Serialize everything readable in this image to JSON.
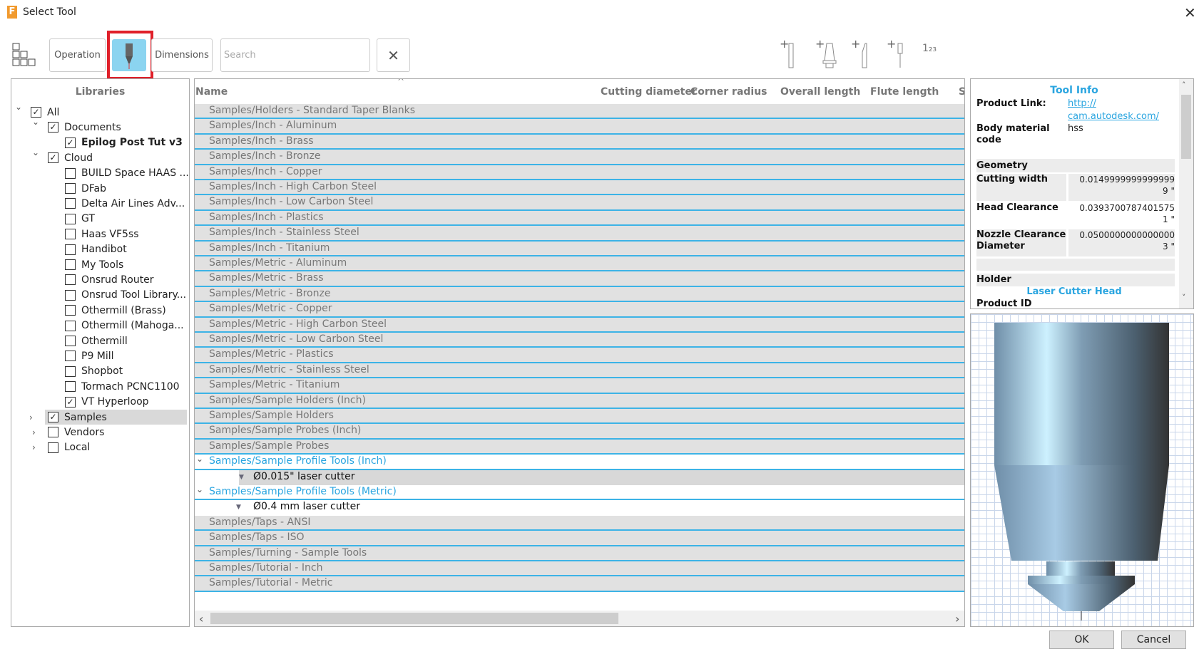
{
  "window": {
    "title": "Select Tool",
    "app_icon": "F"
  },
  "toolbar": {
    "operation": "Operation",
    "dimensions": "Dimensions",
    "search_placeholder": "Search",
    "clear": "✕",
    "number_icon": "1₂₃"
  },
  "libraries": {
    "header": "Libraries",
    "items": [
      {
        "label": "All",
        "checked": true,
        "level": 0,
        "expander": "open"
      },
      {
        "label": "Documents",
        "checked": true,
        "level": 1,
        "expander": "open"
      },
      {
        "label": "Epilog Post Tut v3",
        "checked": true,
        "level": 2,
        "bold": true
      },
      {
        "label": "Cloud",
        "checked": true,
        "level": 1,
        "expander": "open"
      },
      {
        "label": "BUILD Space HAAS ...",
        "checked": false,
        "level": 2
      },
      {
        "label": "DFab",
        "checked": false,
        "level": 2
      },
      {
        "label": "Delta Air Lines Adv...",
        "checked": false,
        "level": 2
      },
      {
        "label": "GT",
        "checked": false,
        "level": 2
      },
      {
        "label": "Haas VF5ss",
        "checked": false,
        "level": 2
      },
      {
        "label": "Handibot",
        "checked": false,
        "level": 2
      },
      {
        "label": "My Tools",
        "checked": false,
        "level": 2
      },
      {
        "label": "Onsrud Router",
        "checked": false,
        "level": 2
      },
      {
        "label": "Onsrud Tool Library...",
        "checked": false,
        "level": 2
      },
      {
        "label": "Othermill (Brass)",
        "checked": false,
        "level": 2
      },
      {
        "label": "Othermill (Mahoga...",
        "checked": false,
        "level": 2
      },
      {
        "label": "Othermill",
        "checked": false,
        "level": 2
      },
      {
        "label": "P9 Mill",
        "checked": false,
        "level": 2
      },
      {
        "label": "Shopbot",
        "checked": false,
        "level": 2
      },
      {
        "label": "Tormach PCNC1100",
        "checked": false,
        "level": 2
      },
      {
        "label": "VT Hyperloop",
        "checked": true,
        "level": 2
      },
      {
        "label": "Samples",
        "checked": true,
        "level": 1,
        "expander": "closed",
        "selected": true
      },
      {
        "label": "Vendors",
        "checked": false,
        "level": 1,
        "expander": "closed"
      },
      {
        "label": "Local",
        "checked": false,
        "level": 1,
        "expander": "closed"
      }
    ]
  },
  "list": {
    "columns": [
      "Name",
      "Cutting diameter",
      "Corner radius",
      "Overall length",
      "Flute length",
      "S"
    ],
    "rows": [
      {
        "label": "Samples/Holders - Standard Taper Blanks",
        "type": "group"
      },
      {
        "label": "Samples/Inch - Aluminum",
        "type": "group"
      },
      {
        "label": "Samples/Inch - Brass",
        "type": "group"
      },
      {
        "label": "Samples/Inch - Bronze",
        "type": "group"
      },
      {
        "label": "Samples/Inch - Copper",
        "type": "group"
      },
      {
        "label": "Samples/Inch - High Carbon Steel",
        "type": "group"
      },
      {
        "label": "Samples/Inch - Low Carbon Steel",
        "type": "group"
      },
      {
        "label": "Samples/Inch - Plastics",
        "type": "group"
      },
      {
        "label": "Samples/Inch - Stainless Steel",
        "type": "group"
      },
      {
        "label": "Samples/Inch - Titanium",
        "type": "group"
      },
      {
        "label": "Samples/Metric - Aluminum",
        "type": "group"
      },
      {
        "label": "Samples/Metric - Brass",
        "type": "group"
      },
      {
        "label": "Samples/Metric - Bronze",
        "type": "group"
      },
      {
        "label": "Samples/Metric - Copper",
        "type": "group"
      },
      {
        "label": "Samples/Metric - High Carbon Steel",
        "type": "group"
      },
      {
        "label": "Samples/Metric - Low Carbon Steel",
        "type": "group"
      },
      {
        "label": "Samples/Metric - Plastics",
        "type": "group"
      },
      {
        "label": "Samples/Metric - Stainless Steel",
        "type": "group"
      },
      {
        "label": "Samples/Metric - Titanium",
        "type": "group"
      },
      {
        "label": "Samples/Sample Holders (Inch)",
        "type": "group"
      },
      {
        "label": "Samples/Sample Holders",
        "type": "group"
      },
      {
        "label": "Samples/Sample Probes (Inch)",
        "type": "group"
      },
      {
        "label": "Samples/Sample Probes",
        "type": "group"
      },
      {
        "label": "Samples/Sample Profile Tools (Inch)",
        "type": "open"
      },
      {
        "label": "Ø0.015\" laser cutter",
        "type": "tool",
        "selected": true
      },
      {
        "label": "Samples/Sample Profile Tools (Metric)",
        "type": "open"
      },
      {
        "label": "Ø0.4 mm laser cutter",
        "type": "tool"
      },
      {
        "label": "Samples/Taps - ANSI",
        "type": "group"
      },
      {
        "label": "Samples/Taps - ISO",
        "type": "group"
      },
      {
        "label": "Samples/Turning - Sample Tools",
        "type": "group"
      },
      {
        "label": "Samples/Tutorial - Inch",
        "type": "group"
      },
      {
        "label": "Samples/Tutorial - Metric",
        "type": "group"
      }
    ]
  },
  "tool_info": {
    "title": "Tool Info",
    "product_link_label": "Product Link:",
    "product_link_1": "http://",
    "product_link_2": "cam.autodesk.com/",
    "body_material_label_1": "Body material",
    "body_material_label_2": "code",
    "body_material": "hss",
    "geometry": "Geometry",
    "cutting_width_label": "Cutting width",
    "cutting_width_1": "0.0149999999999999",
    "cutting_width_2": "9 \"",
    "head_clearance_label": "Head Clearance",
    "head_clearance_1": "0.0393700787401575",
    "head_clearance_2": "1 \"",
    "nozzle_label_1": "Nozzle Clearance",
    "nozzle_label_2": "Diameter",
    "nozzle_1": "0.0500000000000000",
    "nozzle_2": "3 \"",
    "holder": "Holder",
    "holder_name": "Laser Cutter Head",
    "product_id_label": "Product ID"
  },
  "dialog": {
    "ok": "OK",
    "cancel": "Cancel"
  },
  "colors": {
    "accent": "#2aa5e0",
    "selected_button": "#8bd4f0",
    "highlight_box": "#e0202a"
  }
}
